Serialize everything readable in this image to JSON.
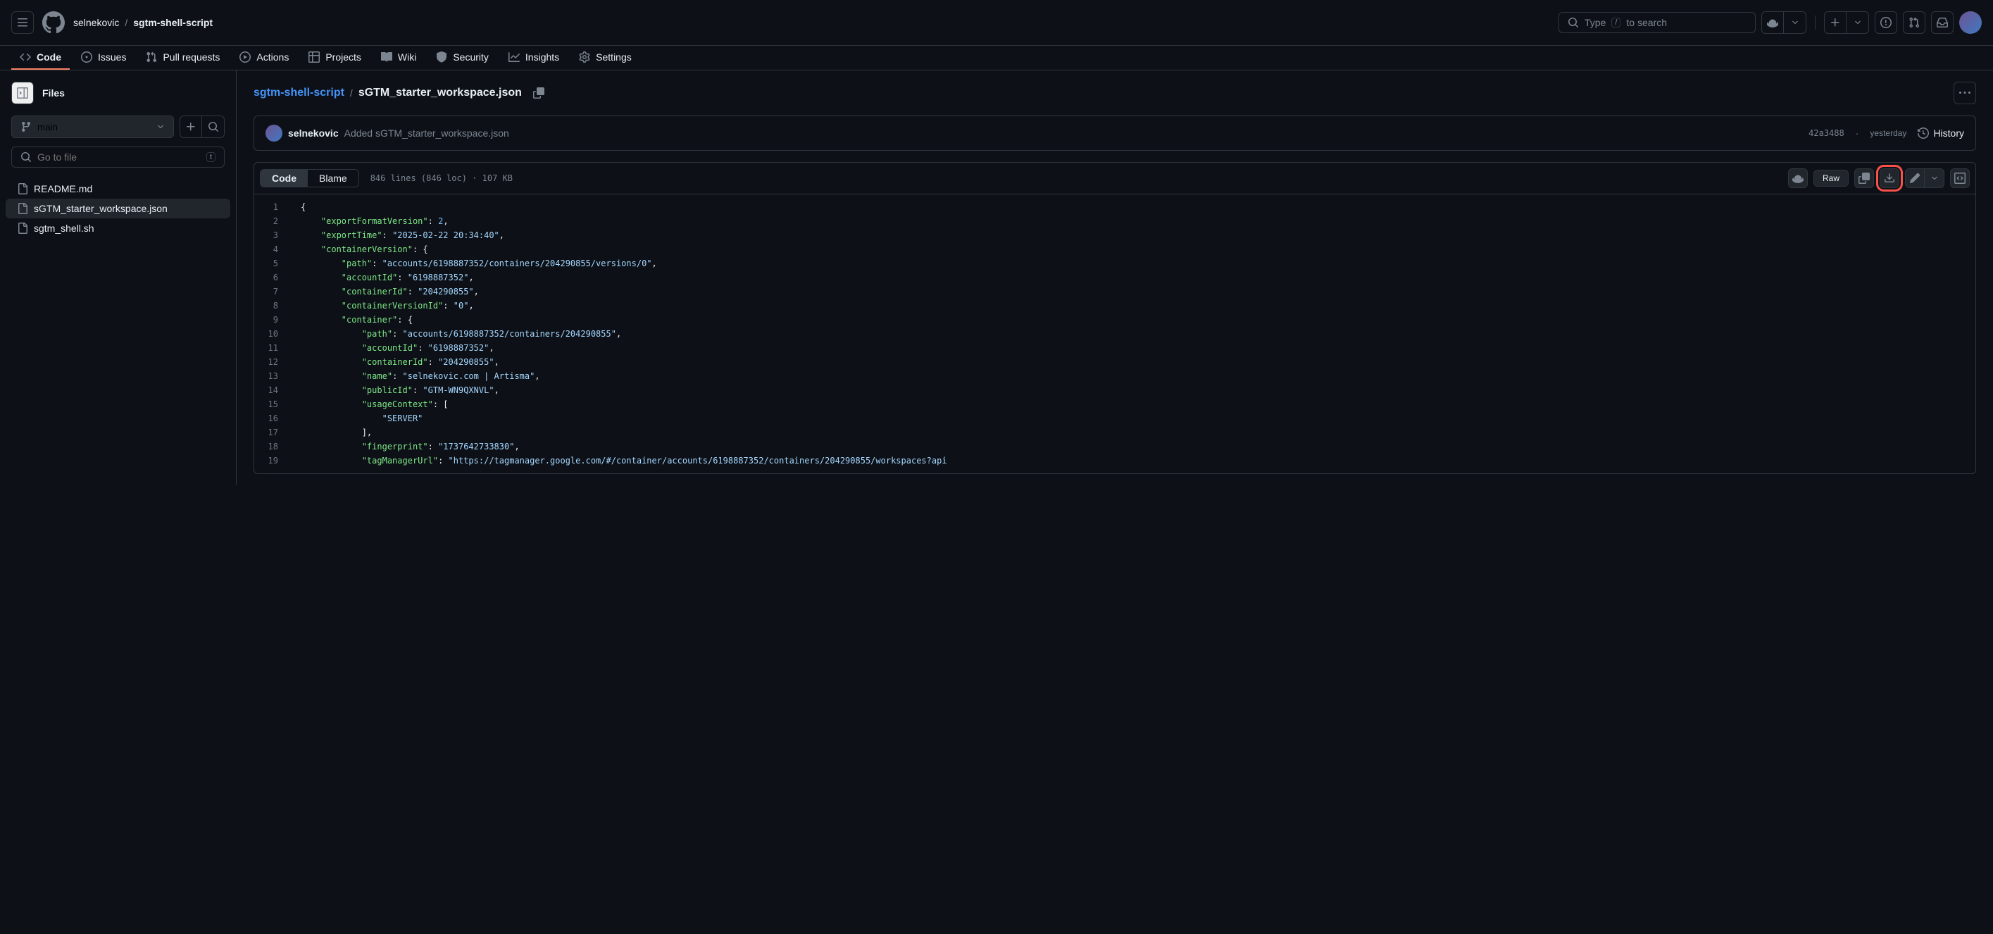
{
  "header": {
    "owner": "selnekovic",
    "repo": "sgtm-shell-script",
    "search_placeholder": "Type",
    "search_hint": "to search"
  },
  "nav": {
    "code": "Code",
    "issues": "Issues",
    "pull_requests": "Pull requests",
    "actions": "Actions",
    "projects": "Projects",
    "wiki": "Wiki",
    "security": "Security",
    "insights": "Insights",
    "settings": "Settings"
  },
  "sidebar": {
    "title": "Files",
    "branch": "main",
    "go_to_file_placeholder": "Go to file",
    "shortcut": "t",
    "files": [
      {
        "name": "README.md"
      },
      {
        "name": "sGTM_starter_workspace.json"
      },
      {
        "name": "sgtm_shell.sh"
      }
    ]
  },
  "path": {
    "repo_link": "sgtm-shell-script",
    "file": "sGTM_starter_workspace.json"
  },
  "commit": {
    "author": "selnekovic",
    "message": "Added sGTM_starter_workspace.json",
    "sha": "42a3488",
    "time": "yesterday",
    "history_label": "History"
  },
  "code_tabs": {
    "code": "Code",
    "blame": "Blame"
  },
  "file_info": "846 lines (846 loc) · 107 KB",
  "raw_label": "Raw",
  "code": {
    "lines": [
      {
        "n": 1,
        "tokens": [
          [
            "punc",
            "{"
          ]
        ]
      },
      {
        "n": 2,
        "tokens": [
          [
            "indent",
            "    "
          ],
          [
            "key",
            "\"exportFormatVersion\""
          ],
          [
            "punc",
            ": "
          ],
          [
            "num",
            "2"
          ],
          [
            "punc",
            ","
          ]
        ]
      },
      {
        "n": 3,
        "tokens": [
          [
            "indent",
            "    "
          ],
          [
            "key",
            "\"exportTime\""
          ],
          [
            "punc",
            ": "
          ],
          [
            "str",
            "\"2025-02-22 20:34:40\""
          ],
          [
            "punc",
            ","
          ]
        ]
      },
      {
        "n": 4,
        "tokens": [
          [
            "indent",
            "    "
          ],
          [
            "key",
            "\"containerVersion\""
          ],
          [
            "punc",
            ": {"
          ]
        ]
      },
      {
        "n": 5,
        "tokens": [
          [
            "indent",
            "        "
          ],
          [
            "key",
            "\"path\""
          ],
          [
            "punc",
            ": "
          ],
          [
            "str",
            "\"accounts/6198887352/containers/204290855/versions/0\""
          ],
          [
            "punc",
            ","
          ]
        ]
      },
      {
        "n": 6,
        "tokens": [
          [
            "indent",
            "        "
          ],
          [
            "key",
            "\"accountId\""
          ],
          [
            "punc",
            ": "
          ],
          [
            "str",
            "\"6198887352\""
          ],
          [
            "punc",
            ","
          ]
        ]
      },
      {
        "n": 7,
        "tokens": [
          [
            "indent",
            "        "
          ],
          [
            "key",
            "\"containerId\""
          ],
          [
            "punc",
            ": "
          ],
          [
            "str",
            "\"204290855\""
          ],
          [
            "punc",
            ","
          ]
        ]
      },
      {
        "n": 8,
        "tokens": [
          [
            "indent",
            "        "
          ],
          [
            "key",
            "\"containerVersionId\""
          ],
          [
            "punc",
            ": "
          ],
          [
            "str",
            "\"0\""
          ],
          [
            "punc",
            ","
          ]
        ]
      },
      {
        "n": 9,
        "tokens": [
          [
            "indent",
            "        "
          ],
          [
            "key",
            "\"container\""
          ],
          [
            "punc",
            ": {"
          ]
        ]
      },
      {
        "n": 10,
        "tokens": [
          [
            "indent",
            "            "
          ],
          [
            "key",
            "\"path\""
          ],
          [
            "punc",
            ": "
          ],
          [
            "str",
            "\"accounts/6198887352/containers/204290855\""
          ],
          [
            "punc",
            ","
          ]
        ]
      },
      {
        "n": 11,
        "tokens": [
          [
            "indent",
            "            "
          ],
          [
            "key",
            "\"accountId\""
          ],
          [
            "punc",
            ": "
          ],
          [
            "str",
            "\"6198887352\""
          ],
          [
            "punc",
            ","
          ]
        ]
      },
      {
        "n": 12,
        "tokens": [
          [
            "indent",
            "            "
          ],
          [
            "key",
            "\"containerId\""
          ],
          [
            "punc",
            ": "
          ],
          [
            "str",
            "\"204290855\""
          ],
          [
            "punc",
            ","
          ]
        ]
      },
      {
        "n": 13,
        "tokens": [
          [
            "indent",
            "            "
          ],
          [
            "key",
            "\"name\""
          ],
          [
            "punc",
            ": "
          ],
          [
            "str",
            "\"selnekovic.com | Artisma\""
          ],
          [
            "punc",
            ","
          ]
        ]
      },
      {
        "n": 14,
        "tokens": [
          [
            "indent",
            "            "
          ],
          [
            "key",
            "\"publicId\""
          ],
          [
            "punc",
            ": "
          ],
          [
            "str",
            "\"GTM-WN9QXNVL\""
          ],
          [
            "punc",
            ","
          ]
        ]
      },
      {
        "n": 15,
        "tokens": [
          [
            "indent",
            "            "
          ],
          [
            "key",
            "\"usageContext\""
          ],
          [
            "punc",
            ": ["
          ]
        ]
      },
      {
        "n": 16,
        "tokens": [
          [
            "indent",
            "                "
          ],
          [
            "str",
            "\"SERVER\""
          ]
        ]
      },
      {
        "n": 17,
        "tokens": [
          [
            "indent",
            "            "
          ],
          [
            "punc",
            "],"
          ]
        ]
      },
      {
        "n": 18,
        "tokens": [
          [
            "indent",
            "            "
          ],
          [
            "key",
            "\"fingerprint\""
          ],
          [
            "punc",
            ": "
          ],
          [
            "str",
            "\"1737642733830\""
          ],
          [
            "punc",
            ","
          ]
        ]
      },
      {
        "n": 19,
        "tokens": [
          [
            "indent",
            "            "
          ],
          [
            "key",
            "\"tagManagerUrl\""
          ],
          [
            "punc",
            ": "
          ],
          [
            "str",
            "\"https://tagmanager.google.com/#/container/accounts/6198887352/containers/204290855/workspaces?api"
          ]
        ]
      }
    ]
  }
}
